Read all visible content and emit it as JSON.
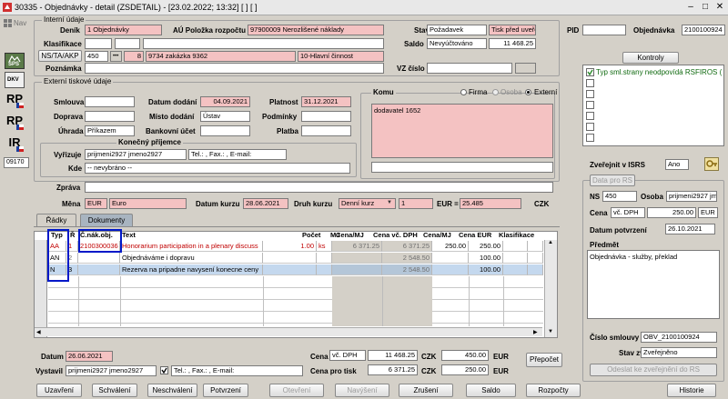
{
  "window": {
    "title": "30335 - Objednávky - detail (ZSDETAIL) - [23.02.2022; 13:32] [ ] [ ]",
    "minimize": "–",
    "maximize": "□",
    "close": "✕"
  },
  "side": {
    "nav": "Nav",
    "sps": "SPS",
    "dkv": "DKV",
    "rp1": "RP",
    "rp2": "RP",
    "ir": "IR",
    "code": "09170"
  },
  "interni": {
    "group": "Interní údaje",
    "denik_label": "Deník",
    "denik_code": "1",
    "denik_value": "1 Objednávky",
    "au_label": "AÚ Položka rozpočtu",
    "au_value": "97900009 Nerozlišené náklady",
    "klas_label": "Klasifikace",
    "ns_label": "NS/TA/AKP",
    "ns1": "450",
    "ns_dots": "•••",
    "ns2": "8",
    "ns3": "9734 zakázka 9362",
    "ns4": "10-Hlavní činnost",
    "poz_label": "Poznámka"
  },
  "stav": {
    "label": "Stav",
    "value": "Požadavek",
    "value2": "Tisk před uveřejn",
    "saldo_label": "Saldo",
    "saldo_value": "Nevyúčtováno",
    "saldo_amount": "11 468.25",
    "vz_label": "VZ číslo"
  },
  "pid": {
    "label": "PID"
  },
  "objednavka": {
    "label": "Objednávka",
    "value": "2100100924"
  },
  "kontroly": {
    "button": "Kontroly",
    "item1": "Typ sml.strany neodpovídá RSFIROS ("
  },
  "externi": {
    "group": "Externí tiskové údaje",
    "smlouva_label": "Smlouva",
    "doprava_label": "Doprava",
    "uhrada_label": "Úhrada",
    "uhrada_value": "Příkazem",
    "datum_label": "Datum dodání",
    "datum_value": "04.09.2021",
    "misto_label": "Místo dodání",
    "misto_value": "Ústav",
    "bank_label": "Bankovní účet",
    "platnost_label": "Platnost",
    "platnost_value": "31.12.2021",
    "podminky_label": "Podmínky",
    "platba_label": "Platba"
  },
  "prijemce": {
    "group": "Konečný příjemce",
    "vyrizuje_label": "Vyřizuje",
    "vyrizuje_value": "prijmeni2927 jmeno2927",
    "contact": "Tel.: , Fax.: , E-mail:",
    "kde_label": "Kde",
    "kde_value": "-- nevybráno --"
  },
  "komu": {
    "group": "Komu",
    "opt_firma": "Firma",
    "opt_osoba": "Osoba",
    "opt_externi": "Externí",
    "text": "dodavatel 1652"
  },
  "zprava_label": "Zpráva",
  "mena": {
    "label": "Měna",
    "code": "EUR",
    "name": "Euro",
    "datum_kurzu_label": "Datum kurzu",
    "datum_kurzu_value": "28.06.2021",
    "druh_label": "Druh kurzu",
    "druh_value": "Denní kurz",
    "kurz_qty": "1",
    "eur_label": "EUR =",
    "kurz_value": "25.485",
    "czk_label": "CZK"
  },
  "tabs": {
    "radky": "Řádky",
    "dokumenty": "Dokumenty"
  },
  "grid": {
    "headers": {
      "typ": "Typ",
      "r": "Ř",
      "cnak": "Č.nák.obj.",
      "text": "Text",
      "pocet": "Počet",
      "mj": "MJ",
      "cenamj": "Cena/MJ",
      "cenavc": "Cena vč. DPH",
      "cenamj2": "Cena/MJ",
      "cenaeur": "Cena EUR",
      "klas": "Klasifikace"
    },
    "rows": [
      {
        "typ": "AA",
        "r": "1",
        "cnak": "2100300036",
        "text": "Honorarium participation in a plenary discuss",
        "pocet": "1.00",
        "mj": "ks",
        "cenamj": "6 371.25",
        "cenavc": "6 371.25",
        "cenamj2": "250.00",
        "cenaeur": "250.00"
      },
      {
        "typ": "AN",
        "r": "2",
        "cnak": "",
        "text": "Objednáváme i dopravu",
        "pocet": "",
        "mj": "",
        "cenamj": "",
        "cenavc": "2 548.50",
        "cenamj2": "",
        "cenaeur": "100.00"
      },
      {
        "typ": "N",
        "r": "3",
        "cnak": "",
        "text": "Rezerva na pripadne navysení konecne ceny",
        "pocet": "",
        "mj": "",
        "cenamj": "",
        "cenavc": "2 548.50",
        "cenamj2": "",
        "cenaeur": "100.00"
      }
    ]
  },
  "bottom": {
    "datum_label": "Datum",
    "datum_value": "26.06.2021",
    "vystavil_label": "Vystavil",
    "vystavil_value": "prijmeni2927 jmeno2927",
    "vystavil_contact": "Tel.: , Fax.: , E-mail:",
    "cena_label": "Cena",
    "cena_type": "vč. DPH",
    "cena_czk": "11 468.25",
    "czk1": "CZK",
    "cena_eur": "450.00",
    "eur1": "EUR",
    "cena_tisk_label": "Cena pro tisk",
    "tisk_czk": "6 371.25",
    "czk2": "CZK",
    "tisk_eur": "250.00",
    "eur2": "EUR",
    "prepocet": "Přepočet"
  },
  "isrs": {
    "label": "Zveřejnit v ISRS",
    "value": "Ano",
    "group": "Data pro RS",
    "ns_label": "NS",
    "ns_value": "450",
    "osoba_label": "Osoba",
    "osoba_value": "prijmeni2927 jmeno2927",
    "cena_label": "Cena",
    "cena_type": "vč. DPH",
    "cena_value": "250.00",
    "cena_cur": "EUR",
    "datum_label": "Datum potvrzení",
    "datum_value": "26.10.2021",
    "predmet_label": "Předmět",
    "predmet_value": "Objednávka - služby, překlad",
    "smlouva_label": "Číslo smlouvy",
    "smlouva_value": "OBV_2100100924",
    "stav_label": "Stav zveř.",
    "stav_value": "Zveřejněno",
    "odeslat": "Odeslat ke zveřejnění do RS"
  },
  "buttons": {
    "uzavreni": "Uzavření",
    "schvaleni": "Schválení",
    "neschvaleni": "Neschválení",
    "potvrzeni": "Potvrzení",
    "otevreni": "Otevření",
    "navyseni": "Navýšení",
    "zruseni": "Zrušení",
    "saldo": "Saldo",
    "rozpocty": "Rozpočty",
    "historie": "Historie"
  }
}
